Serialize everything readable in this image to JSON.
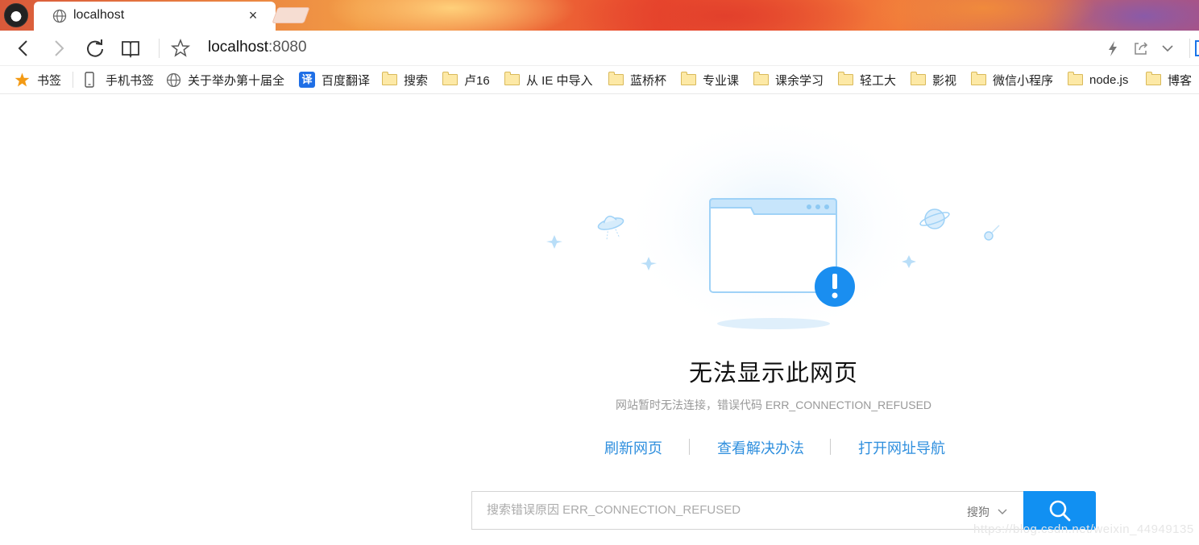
{
  "tab": {
    "title": "localhost",
    "close_symbol": "×"
  },
  "address": {
    "host": "localhost",
    "port": ":8080"
  },
  "bookmarks": [
    {
      "label": "书签",
      "icon": "star-icon"
    },
    {
      "label": "手机书签",
      "icon": "phone-icon"
    },
    {
      "label": "关于举办第十届全",
      "icon": "globe-icon"
    },
    {
      "label": "百度翻译",
      "icon": "translate-icon",
      "icon_text": "译"
    },
    {
      "label": "搜索",
      "icon": "folder-icon"
    },
    {
      "label": "卢16",
      "icon": "folder-icon"
    },
    {
      "label": "从 IE 中导入",
      "icon": "folder-icon"
    },
    {
      "label": "蓝桥杯",
      "icon": "folder-icon"
    },
    {
      "label": "专业课",
      "icon": "folder-icon"
    },
    {
      "label": "课余学习",
      "icon": "folder-icon"
    },
    {
      "label": "轻工大",
      "icon": "folder-icon"
    },
    {
      "label": "影视",
      "icon": "folder-icon"
    },
    {
      "label": "微信小程序",
      "icon": "folder-icon"
    },
    {
      "label": "node.js",
      "icon": "folder-icon"
    },
    {
      "label": "博客",
      "icon": "folder-icon"
    }
  ],
  "error": {
    "title": "无法显示此网页",
    "description": "网站暂时无法连接，错误代码 ERR_CONNECTION_REFUSED",
    "actions": [
      "刷新网页",
      "查看解决办法",
      "打开网址导航"
    ]
  },
  "search": {
    "placeholder": "搜索错误原因 ERR_CONNECTION_REFUSED",
    "engine": "搜狗"
  },
  "watermark": "https://blog.csdn.net/weixin_44949135",
  "colors": {
    "accent": "#1190f2",
    "link": "#2f8fde",
    "illustration": "#7cc3f5"
  }
}
